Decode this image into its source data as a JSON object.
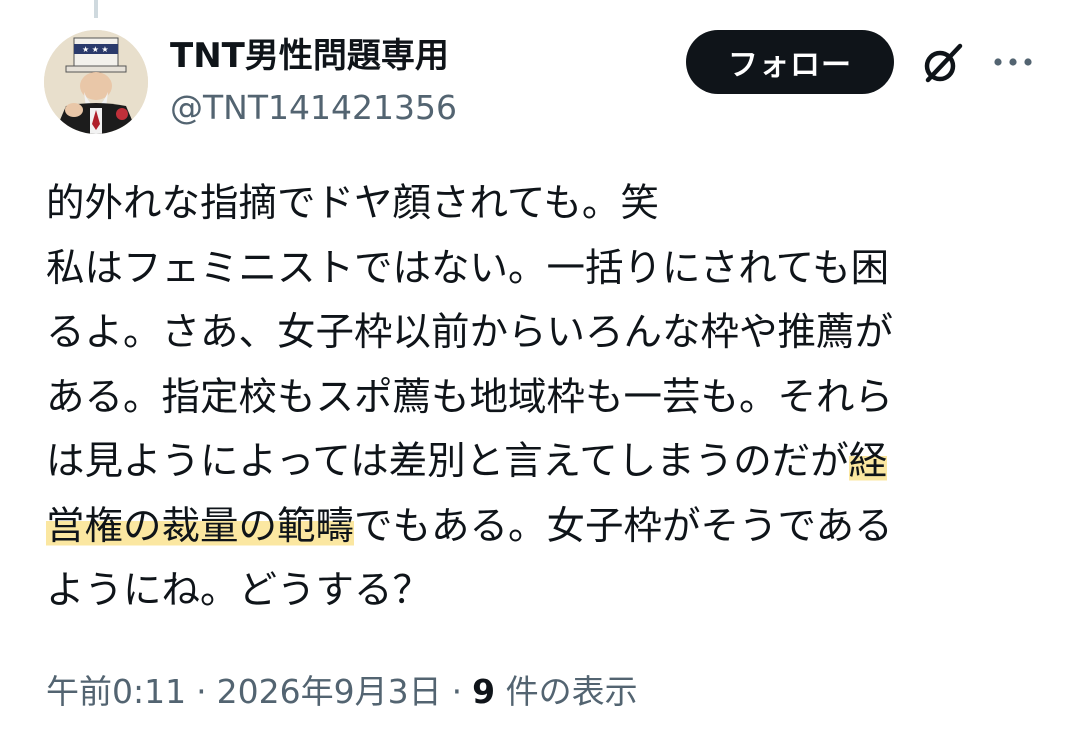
{
  "author": {
    "display_name": "TNT男性問題専用",
    "handle": "@TNT141421356"
  },
  "actions": {
    "follow_label": "フォロー",
    "grok_icon": "grok-icon",
    "more_icon": "more-dots-icon"
  },
  "tweet": {
    "lines": [
      "的外れな指摘でドヤ顔されても。笑",
      "私はフェミニストではない。一括りにされても困",
      "るよ。さあ、女子枠以前からいろんな枠や推薦が",
      "ある。指定校もスポ薦も地域枠も一芸も。それら",
      "は見ようによっては差別と言えてしまうのだが"
    ],
    "line5_highlight": "経",
    "line6_highlight": "営権の裁量の範疇",
    "line6_rest": "でもある。女子枠がそうである",
    "line7": "ようにね。どうする？",
    "highlight_color": "#fbe7a1"
  },
  "meta": {
    "time": "午前0:11",
    "date": "2026年9月3日",
    "view_count": "9",
    "view_label": "件の表示",
    "separator": "·"
  }
}
